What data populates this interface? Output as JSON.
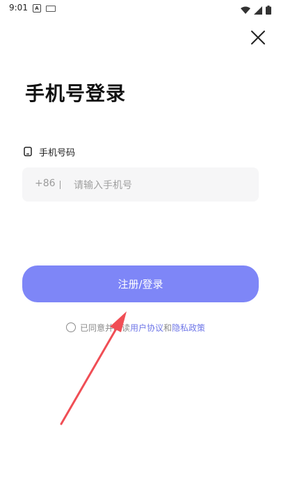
{
  "status_bar": {
    "time": "9:01",
    "icons": [
      "a-icon",
      "keyboard-icon",
      "wifi-icon",
      "signal-icon",
      "battery-icon"
    ]
  },
  "header": {
    "close_icon": "close-icon"
  },
  "page": {
    "title": "手机号登录"
  },
  "phone": {
    "label_icon": "phone-icon",
    "label": "手机号码",
    "country_code": "+86",
    "placeholder": "请输入手机号",
    "value": ""
  },
  "actions": {
    "submit_label": "注册/登录"
  },
  "agreement": {
    "prefix": "已同意并阅读",
    "user_agreement": "用户协议",
    "and": "和",
    "privacy_policy": "隐私政策",
    "checked": false
  },
  "annotation": {
    "arrow_color": "#f04e55"
  },
  "colors": {
    "accent": "#7e86f7",
    "link": "#6f77e8",
    "input_bg": "#f6f6f7"
  }
}
